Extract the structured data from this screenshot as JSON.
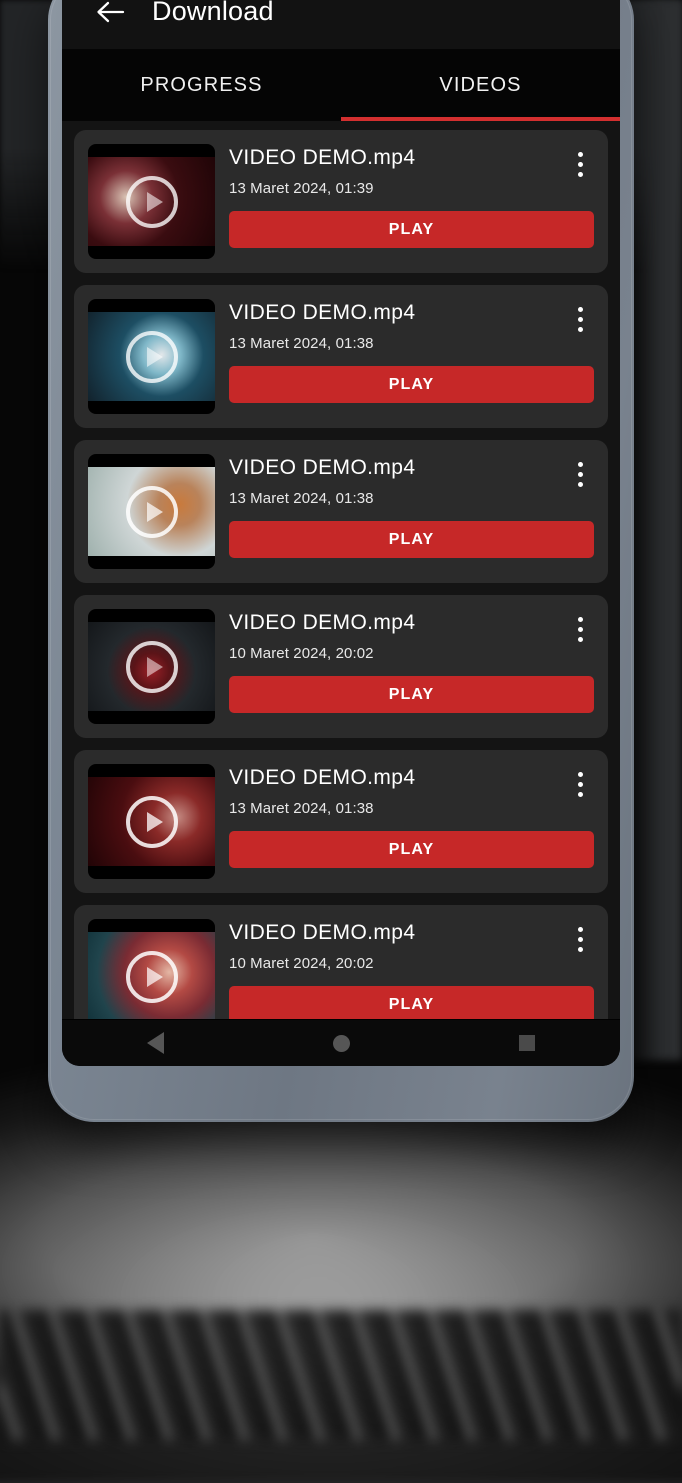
{
  "app": {
    "title": "Download",
    "back_icon": "arrow-left-icon"
  },
  "tabs": [
    {
      "label": "PROGRESS",
      "active": false
    },
    {
      "label": "VIDEOS",
      "active": true
    }
  ],
  "colors": {
    "accent_red": "#c62828",
    "tab_indicator": "#d32f2f",
    "card_bg": "#2b2b2b",
    "screen_bg": "#141414",
    "appbar_bg": "#121212",
    "phone_frame": "#7c8794"
  },
  "videos": [
    {
      "name": "VIDEO DEMO.mp4",
      "date": "13 Maret 2024, 01:39",
      "action": "PLAY",
      "menu_icon": "more-vertical-icon",
      "thumb_icon": "play-circle-icon"
    },
    {
      "name": "VIDEO DEMO.mp4",
      "date": "13 Maret 2024, 01:38",
      "action": "PLAY",
      "menu_icon": "more-vertical-icon",
      "thumb_icon": "play-circle-icon"
    },
    {
      "name": "VIDEO DEMO.mp4",
      "date": "13 Maret 2024, 01:38",
      "action": "PLAY",
      "menu_icon": "more-vertical-icon",
      "thumb_icon": "play-circle-icon"
    },
    {
      "name": "VIDEO DEMO.mp4",
      "date": "10 Maret 2024, 20:02",
      "action": "PLAY",
      "menu_icon": "more-vertical-icon",
      "thumb_icon": "play-circle-icon"
    },
    {
      "name": "VIDEO DEMO.mp4",
      "date": "13 Maret 2024, 01:38",
      "action": "PLAY",
      "menu_icon": "more-vertical-icon",
      "thumb_icon": "play-circle-icon"
    },
    {
      "name": "VIDEO DEMO.mp4",
      "date": "10 Maret 2024, 20:02",
      "action": "PLAY",
      "menu_icon": "more-vertical-icon",
      "thumb_icon": "play-circle-icon"
    }
  ],
  "navbar": [
    {
      "icon": "triangle-back-icon"
    },
    {
      "icon": "circle-home-icon"
    },
    {
      "icon": "square-recents-icon"
    }
  ]
}
